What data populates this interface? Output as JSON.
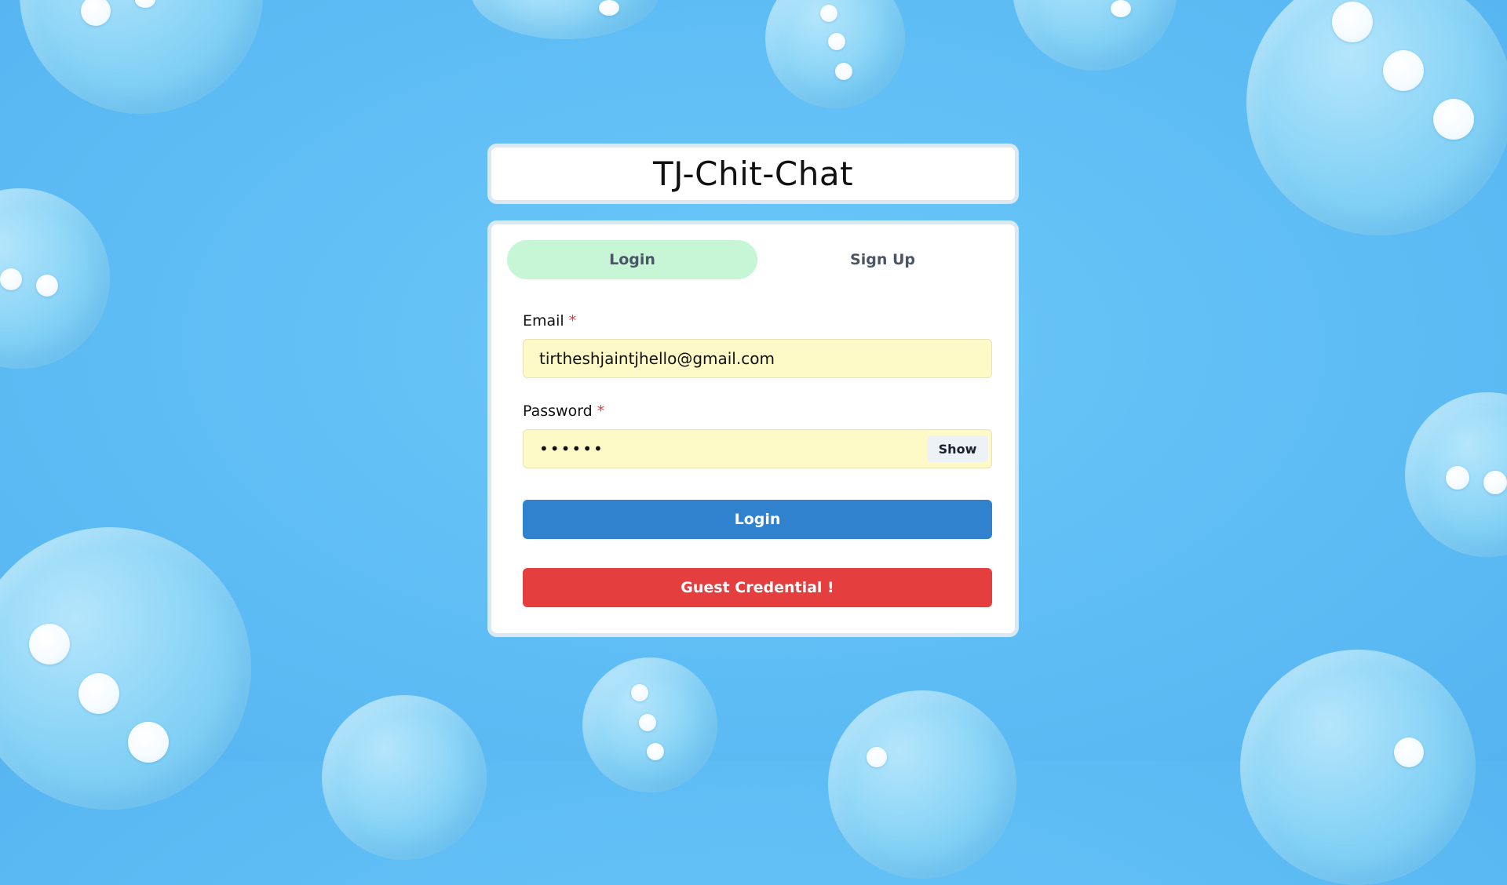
{
  "header": {
    "title": "TJ-Chit-Chat"
  },
  "tabs": [
    {
      "label": "Login",
      "active": true
    },
    {
      "label": "Sign Up",
      "active": false
    }
  ],
  "form": {
    "email_label": "Email",
    "email_required": "*",
    "email_value": "tirtheshjaintjhello@gmail.com",
    "password_label": "Password",
    "password_required": "*",
    "password_value": "••••••",
    "show_label": "Show",
    "login_label": "Login",
    "guest_label": "Guest Credential !"
  },
  "colors": {
    "background": "#5fbdf5",
    "active_tab": "#c6f6d5",
    "input_fill": "#fefac7",
    "login_button": "#3182ce",
    "guest_button": "#e53e3e",
    "required_mark": "#e53e3e"
  }
}
